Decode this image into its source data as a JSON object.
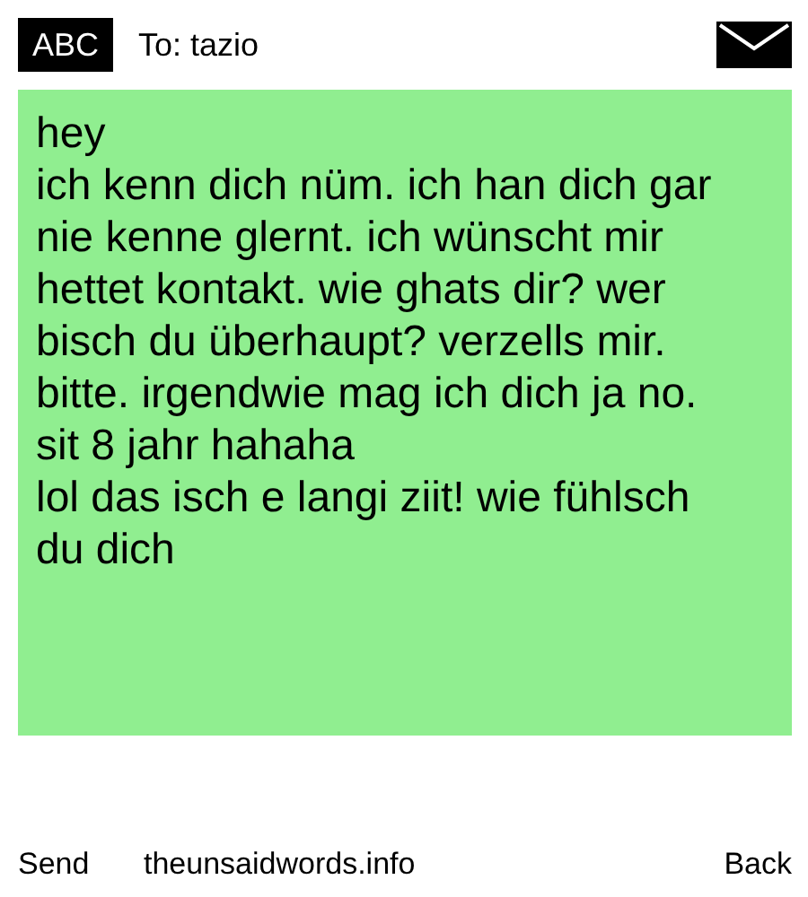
{
  "header": {
    "input_mode": "ABC",
    "recipient": "To: tazio"
  },
  "message": "hey\nich kenn dich nüm. ich han dich gar nie kenne glernt. ich wünscht mir hettet kontakt. wie ghats dir? wer bisch du überhaupt? verzells mir. bitte. irgendwie mag ich dich ja no. sit 8 jahr hahaha\nlol das isch e langi ziit! wie fühlsch du dich",
  "softkeys": {
    "left": "Send",
    "center": "theunsaidwords.info",
    "right": "Back"
  }
}
